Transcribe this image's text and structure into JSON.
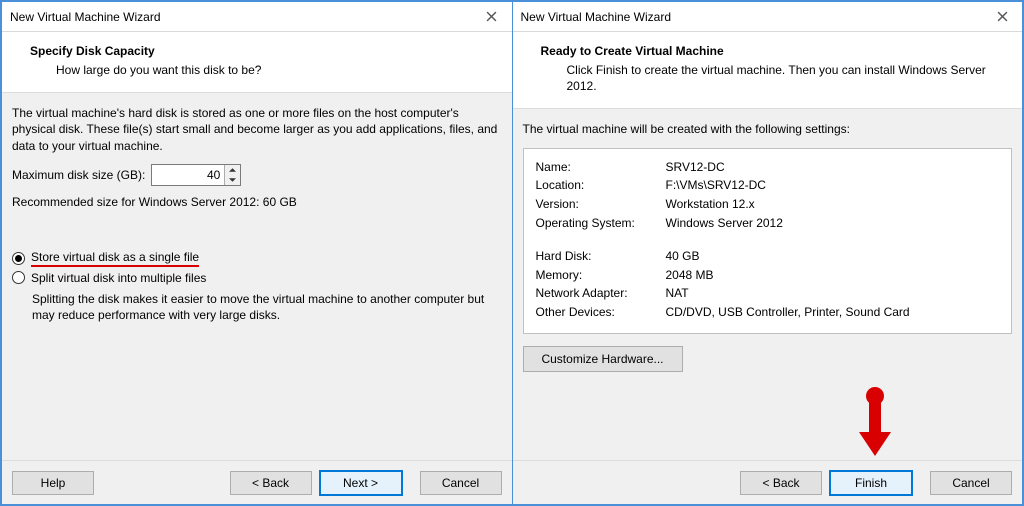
{
  "left": {
    "window_title": "New Virtual Machine Wizard",
    "header_title": "Specify Disk Capacity",
    "header_sub": "How large do you want this disk to be?",
    "intro": "The virtual machine's hard disk is stored as one or more files on the host computer's physical disk. These file(s) start small and become larger as you add applications, files, and data to your virtual machine.",
    "size_label": "Maximum disk size (GB):",
    "size_value": "40",
    "recommended": "Recommended size for Windows Server 2012: 60 GB",
    "radio_single": "Store virtual disk as a single file",
    "radio_split": "Split virtual disk into multiple files",
    "split_note": "Splitting the disk makes it easier to move the virtual machine to another computer but may reduce performance with very large disks.",
    "help": "Help",
    "back": "< Back",
    "next": "Next >",
    "cancel": "Cancel"
  },
  "right": {
    "window_title": "New Virtual Machine Wizard",
    "header_title": "Ready to Create Virtual Machine",
    "header_sub": "Click Finish to create the virtual machine. Then you can install Windows Server 2012.",
    "intro": "The virtual machine will be created with the following settings:",
    "rows1": [
      {
        "k": "Name:",
        "v": "SRV12-DC"
      },
      {
        "k": "Location:",
        "v": "F:\\VMs\\SRV12-DC"
      },
      {
        "k": "Version:",
        "v": "Workstation 12.x"
      },
      {
        "k": "Operating System:",
        "v": "Windows Server 2012"
      }
    ],
    "rows2": [
      {
        "k": "Hard Disk:",
        "v": "40 GB"
      },
      {
        "k": "Memory:",
        "v": "2048 MB"
      },
      {
        "k": "Network Adapter:",
        "v": "NAT"
      },
      {
        "k": "Other Devices:",
        "v": "CD/DVD, USB Controller, Printer, Sound Card"
      }
    ],
    "customize": "Customize Hardware...",
    "back": "< Back",
    "finish": "Finish",
    "cancel": "Cancel"
  }
}
